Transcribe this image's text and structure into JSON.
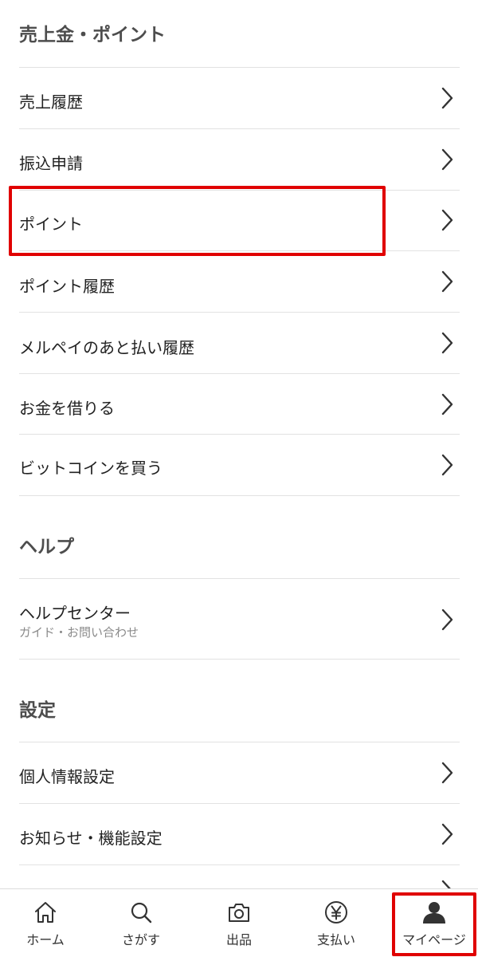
{
  "sections": {
    "sales": {
      "title": "売上金・ポイント",
      "items": [
        "売上履歴",
        "振込申請",
        "ポイント",
        "ポイント履歴",
        "メルペイのあと払い履歴",
        "お金を借りる",
        "ビットコインを買う"
      ]
    },
    "help": {
      "title": "ヘルプ",
      "item_label": "ヘルプセンター",
      "item_sub": "ガイド・お問い合わせ"
    },
    "settings": {
      "title": "設定",
      "items": [
        "個人情報設定",
        "お知らせ・機能設定"
      ]
    }
  },
  "tabbar": {
    "home": "ホーム",
    "search": "さがす",
    "sell": "出品",
    "pay": "支払い",
    "mypage": "マイページ"
  },
  "colors": {
    "highlight": "#e00000",
    "divider": "#e2e2e2",
    "chevron": "#333333"
  }
}
